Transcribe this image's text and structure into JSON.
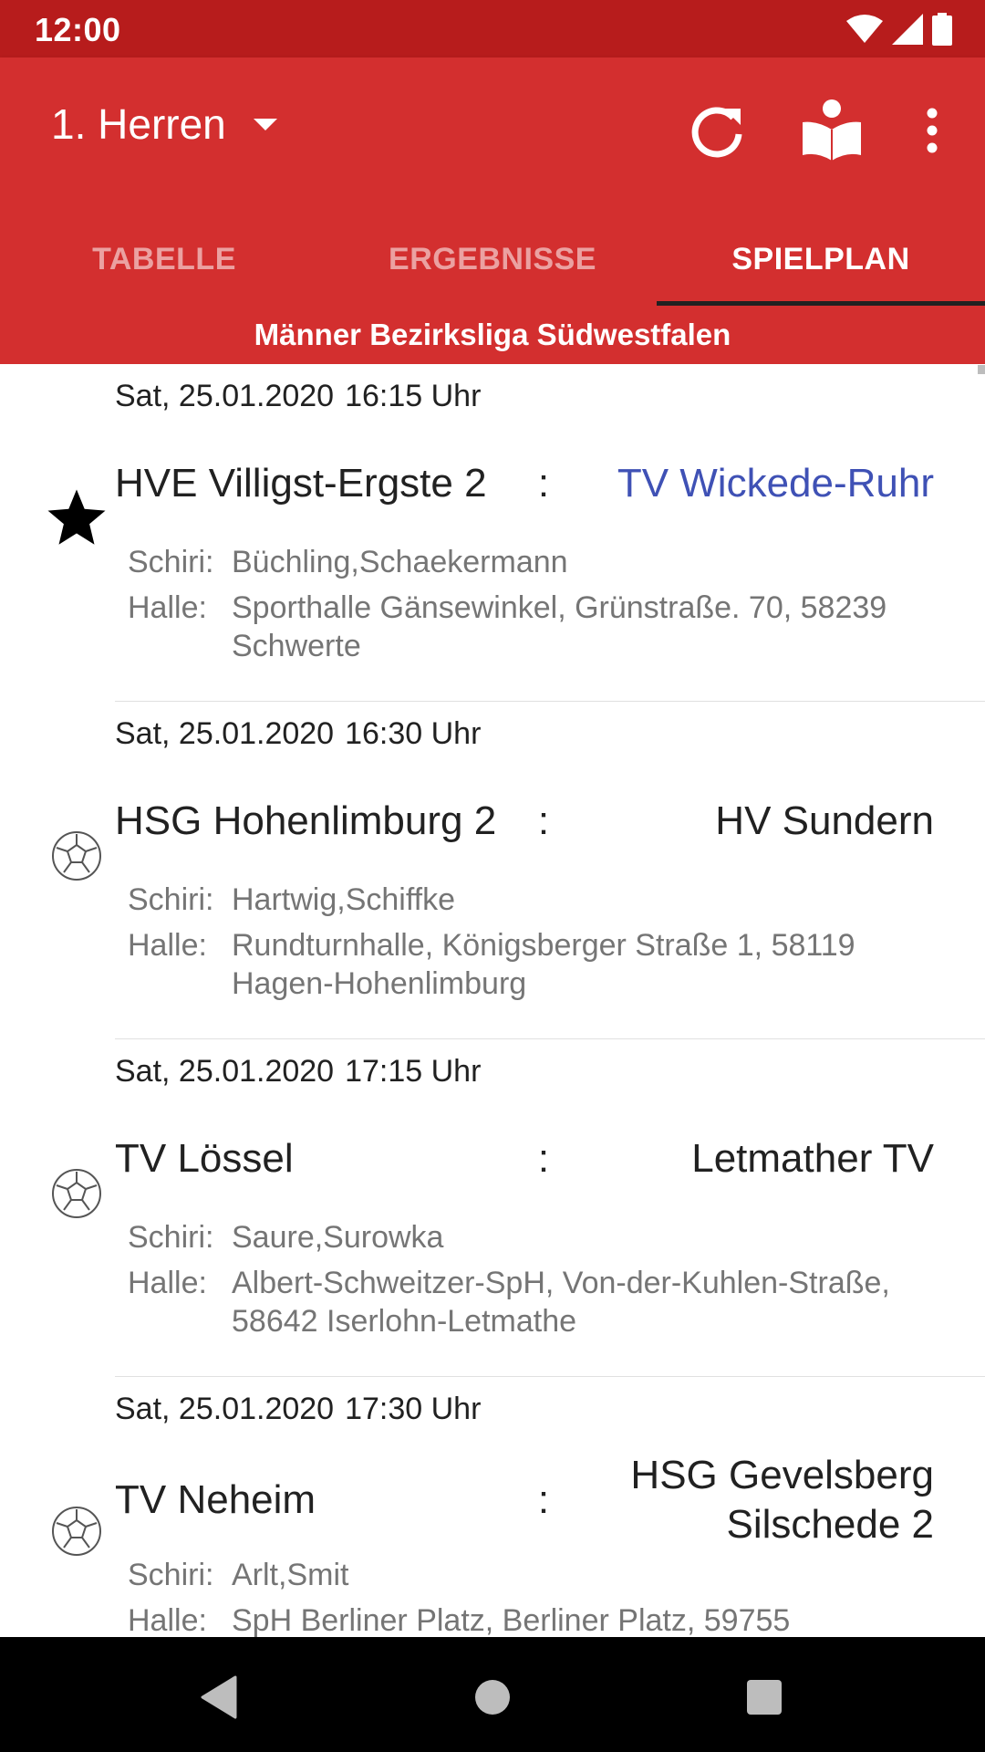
{
  "status_bar": {
    "time": "12:00"
  },
  "app_bar": {
    "team": "1. Herren",
    "actions": [
      "refresh-icon",
      "book-reader-icon",
      "more-vert-icon"
    ],
    "tabs": [
      {
        "label": "TABELLE",
        "active": false
      },
      {
        "label": "ERGEBNISSE",
        "active": false
      },
      {
        "label": "SPIELPLAN",
        "active": true
      }
    ]
  },
  "league": "Männer Bezirksliga Südwestfalen",
  "matches": [
    {
      "date": "Sat, 25.01.2020",
      "time": "16:15 Uhr",
      "home": "HVE Villigst-Ergste 2",
      "colon": ":",
      "guest": "TV Wickede-Ruhr",
      "schiri_label": "Schiri:",
      "schiri": "Büchling,Schaekermann",
      "halle_label": "Halle:",
      "halle": "Sporthalle Gänsewinkel, Grünstraße. 70, 58239 Schwerte",
      "icon": "star-icon"
    },
    {
      "date": "Sat, 25.01.2020",
      "time": "16:30 Uhr",
      "home": "HSG Hohenlimburg 2",
      "colon": ":",
      "guest": "HV Sundern",
      "schiri_label": "Schiri:",
      "schiri": "Hartwig,Schiffke",
      "halle_label": "Halle:",
      "halle": "Rundturnhalle, Königsberger Straße 1, 58119 Hagen-Hohenlimburg",
      "icon": "handball-icon"
    },
    {
      "date": "Sat, 25.01.2020",
      "time": "17:15 Uhr",
      "home": "TV Lössel",
      "colon": ":",
      "guest": "Letmather TV",
      "schiri_label": "Schiri:",
      "schiri": "Saure,Surowka",
      "halle_label": "Halle:",
      "halle": "Albert-Schweitzer-SpH, Von-der-Kuhlen-Straße, 58642 Iserlohn-Letmathe",
      "icon": "handball-icon"
    },
    {
      "date": "Sat, 25.01.2020",
      "time": "17:30 Uhr",
      "home": "TV Neheim",
      "colon": ":",
      "guest": "HSG Gevelsberg Silschede 2",
      "schiri_label": "Schiri:",
      "schiri": "Arlt,Smit",
      "halle_label": "Halle:",
      "halle": "SpH Berliner Platz, Berliner Platz, 59755",
      "icon": "handball-icon"
    }
  ],
  "colors": {
    "primary": "#d32f2f",
    "status_bar": "#b71c1c",
    "highlight": "#3f51b5"
  }
}
